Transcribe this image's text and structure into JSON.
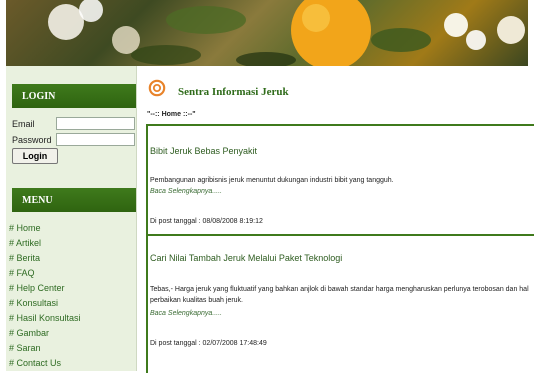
{
  "login": {
    "heading": "LOGIN",
    "email_label": "Email",
    "password_label": "Password",
    "button": "Login"
  },
  "menu": {
    "heading": "MENU",
    "items": [
      "# Home",
      "# Artikel",
      "# Berita",
      "# FAQ",
      "# Help Center",
      "# Konsultasi",
      "# Hasil Konsultasi",
      "# Gambar",
      "# Saran",
      "# Contact Us"
    ]
  },
  "site": {
    "title": "Sentra Informasi Jeruk"
  },
  "breadcrumb": "\"--:: Home ::--\"",
  "articles": [
    {
      "title": "Bibit Jeruk Bebas Penyakit",
      "excerpt": "Pembangunan agribisnis jeruk menuntut dukungan industri bibit yang tangguh.",
      "read_more": "Baca Selengkapnya.....",
      "posted": "Di post tanggal : 08/08/2008 8:19:12"
    },
    {
      "title": "Cari Nilai Tambah Jeruk Melalui Paket Teknologi",
      "excerpt": "Tebas,- Harga jeruk yang fluktuatif yang bahkan anjlok di bawah standar harga mengharuskan perlunya terobosan dan hal perbaikan kualitas buah jeruk.",
      "read_more": "Baca Selengkapnya.....",
      "posted": "Di post tanggal : 02/07/2008 17:48:49"
    }
  ],
  "colors": {
    "accent": "#3f7a1c",
    "sidebar_bg": "#e9f1df",
    "link": "#2e6b22"
  },
  "icons": {
    "logo": "swirl-logo-icon"
  }
}
